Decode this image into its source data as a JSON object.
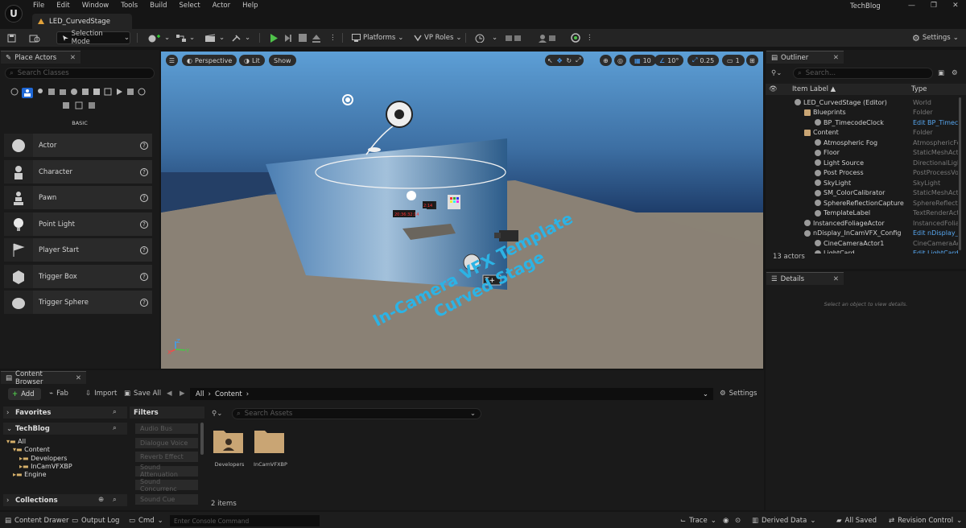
{
  "app": {
    "logo": "U",
    "menu": [
      "File",
      "Edit",
      "Window",
      "Tools",
      "Build",
      "Select",
      "Actor",
      "Help"
    ],
    "tab_title": "LED_CurvedStage",
    "project": "TechBlog",
    "win_controls": [
      "—",
      "❐",
      "✕"
    ]
  },
  "toolbar": {
    "mode": "Selection Mode",
    "platforms": "Platforms",
    "vp_roles": "VP Roles",
    "settings": "Settings"
  },
  "place_actors": {
    "tab": "Place Actors",
    "search_placeholder": "Search Classes",
    "category": "BASIC",
    "items": [
      {
        "label": "Actor",
        "icon": "sphere-icon"
      },
      {
        "label": "Character",
        "icon": "character-icon"
      },
      {
        "label": "Pawn",
        "icon": "pawn-icon"
      },
      {
        "label": "Point Light",
        "icon": "bulb-icon"
      },
      {
        "label": "Player Start",
        "icon": "flag-icon"
      },
      {
        "label": "Trigger Box",
        "icon": "cube-icon"
      },
      {
        "label": "Trigger Sphere",
        "icon": "sphere-icon"
      }
    ]
  },
  "viewport": {
    "perspective": "Perspective",
    "lit": "Lit",
    "show": "Show",
    "grid": "10",
    "angle": "10°",
    "scale": "0.25",
    "camspeed": "1",
    "text_line1": "In-Camera VFX Template",
    "text_line2": "Curved Stage",
    "timecode1": "20:36:32:14",
    "timecode2": "2:14",
    "axis_x": "X",
    "axis_y": "Y",
    "axis_z": "Z"
  },
  "outliner": {
    "tab": "Outliner",
    "search_placeholder": "Search...",
    "col_label": "Item Label ▲",
    "col_type": "Type",
    "count": "13 actors",
    "rows": [
      {
        "name": "LED_CurvedStage (Editor)",
        "type": "World",
        "indent": 0,
        "link": false
      },
      {
        "name": "Blueprints",
        "type": "Folder",
        "indent": 1,
        "link": false
      },
      {
        "name": "BP_TimecodeClock",
        "type": "Edit BP_Timec",
        "indent": 2,
        "link": true
      },
      {
        "name": "Content",
        "type": "Folder",
        "indent": 1,
        "link": false
      },
      {
        "name": "Atmospheric Fog",
        "type": "AtmosphericFo",
        "indent": 2,
        "link": false
      },
      {
        "name": "Floor",
        "type": "StaticMeshAct",
        "indent": 2,
        "link": false
      },
      {
        "name": "Light Source",
        "type": "DirectionalLigh",
        "indent": 2,
        "link": false
      },
      {
        "name": "Post Process",
        "type": "PostProcessVo",
        "indent": 2,
        "link": false
      },
      {
        "name": "SkyLight",
        "type": "SkyLight",
        "indent": 2,
        "link": false
      },
      {
        "name": "SM_ColorCalibrator",
        "type": "StaticMeshAct",
        "indent": 2,
        "link": false
      },
      {
        "name": "SphereReflectionCapture",
        "type": "SphereReflecti",
        "indent": 2,
        "link": false
      },
      {
        "name": "TemplateLabel",
        "type": "TextRenderAct",
        "indent": 2,
        "link": false
      },
      {
        "name": "InstancedFoliageActor",
        "type": "InstancedFolia",
        "indent": 1,
        "link": false
      },
      {
        "name": "nDisplay_InCamVFX_Config",
        "type": "Edit nDisplay_",
        "indent": 1,
        "link": true
      },
      {
        "name": "CineCameraActor1",
        "type": "CineCameraAc",
        "indent": 2,
        "link": false
      },
      {
        "name": "LightCard",
        "type": "Edit LightCard",
        "indent": 2,
        "link": true
      }
    ]
  },
  "details": {
    "tab": "Details",
    "empty": "Select an object to view details."
  },
  "content_browser": {
    "tab": "Content Browser",
    "add": "Add",
    "fab": "Fab",
    "import": "Import",
    "save_all": "Save All",
    "path": [
      "All",
      "Content"
    ],
    "settings": "Settings",
    "favorites": "Favorites",
    "project": "TechBlog",
    "tree": [
      "All",
      "Content",
      "Developers",
      "InCamVFXBP",
      "Engine"
    ],
    "collections": "Collections",
    "filters_title": "Filters",
    "filters": [
      "Audio Bus",
      "Dialogue Voice",
      "Reverb Effect",
      "Sound Attenuation",
      "Sound Concurrenc",
      "Sound Cue"
    ],
    "search_placeholder": "Search Assets",
    "assets": [
      "Developers",
      "InCamVFXBP"
    ],
    "count": "2 items"
  },
  "statusbar": {
    "drawer": "Content Drawer",
    "output": "Output Log",
    "cmd": "Cmd",
    "console_placeholder": "Enter Console Command",
    "trace": "Trace",
    "derived": "Derived Data",
    "saved": "All Saved",
    "revision": "Revision Control"
  }
}
